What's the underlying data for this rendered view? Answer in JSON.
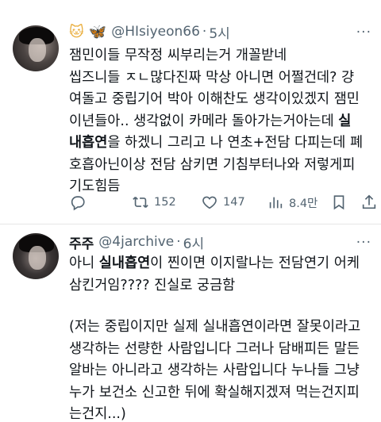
{
  "tweets": [
    {
      "emoji_1": "cat-face",
      "emoji_2": "butterfly",
      "display_name": "",
      "handle": "@HIsiyeon66",
      "time": "5시",
      "lines": [
        "잼민이들 무작정 씨부리는거 개꼴받네",
        "씹즈니들 ㅈㄴ많다진짜 막상 아니면 어쩔건데? 걍",
        "여돌고 중립기어 박아 이해찬도 생각이있겠지 잼민",
        "이년들아.. 생각없이 카메라 돌아가는거아는데 실",
        "내흡연을 하겠니 그리고 나 연초+전담 다피는데 폐",
        "호흡아닌이상 전담 삼키면 기침부터나와 저렇게피",
        "기도힘듬"
      ],
      "actions": {
        "reply_count": "",
        "retweet_count": "152",
        "like_count": "147",
        "view_count": "8.4만"
      }
    },
    {
      "display_name": "주주",
      "handle": "@4jarchive",
      "time": "6시",
      "lines": [
        "아니 실내흡연이 찐이면 이지랄나는 전담연기 어케",
        "삼킨거임???? 진실로 궁금함"
      ],
      "lines_2": [
        "(저는 중립이지만 실제 실내흡연이라면 잘못이라고",
        "생각하는 선량한 사람입니다 그러나 담배피든 말든",
        "알바는 아니라고 생각하는 사람입니다 누나들 그냥",
        "누가 보건소 신고한 뒤에 확실해지겠져 먹는건지피",
        "는건지...)"
      ]
    }
  ],
  "colors": {
    "text": "#0f1419",
    "secondary": "#536471"
  }
}
